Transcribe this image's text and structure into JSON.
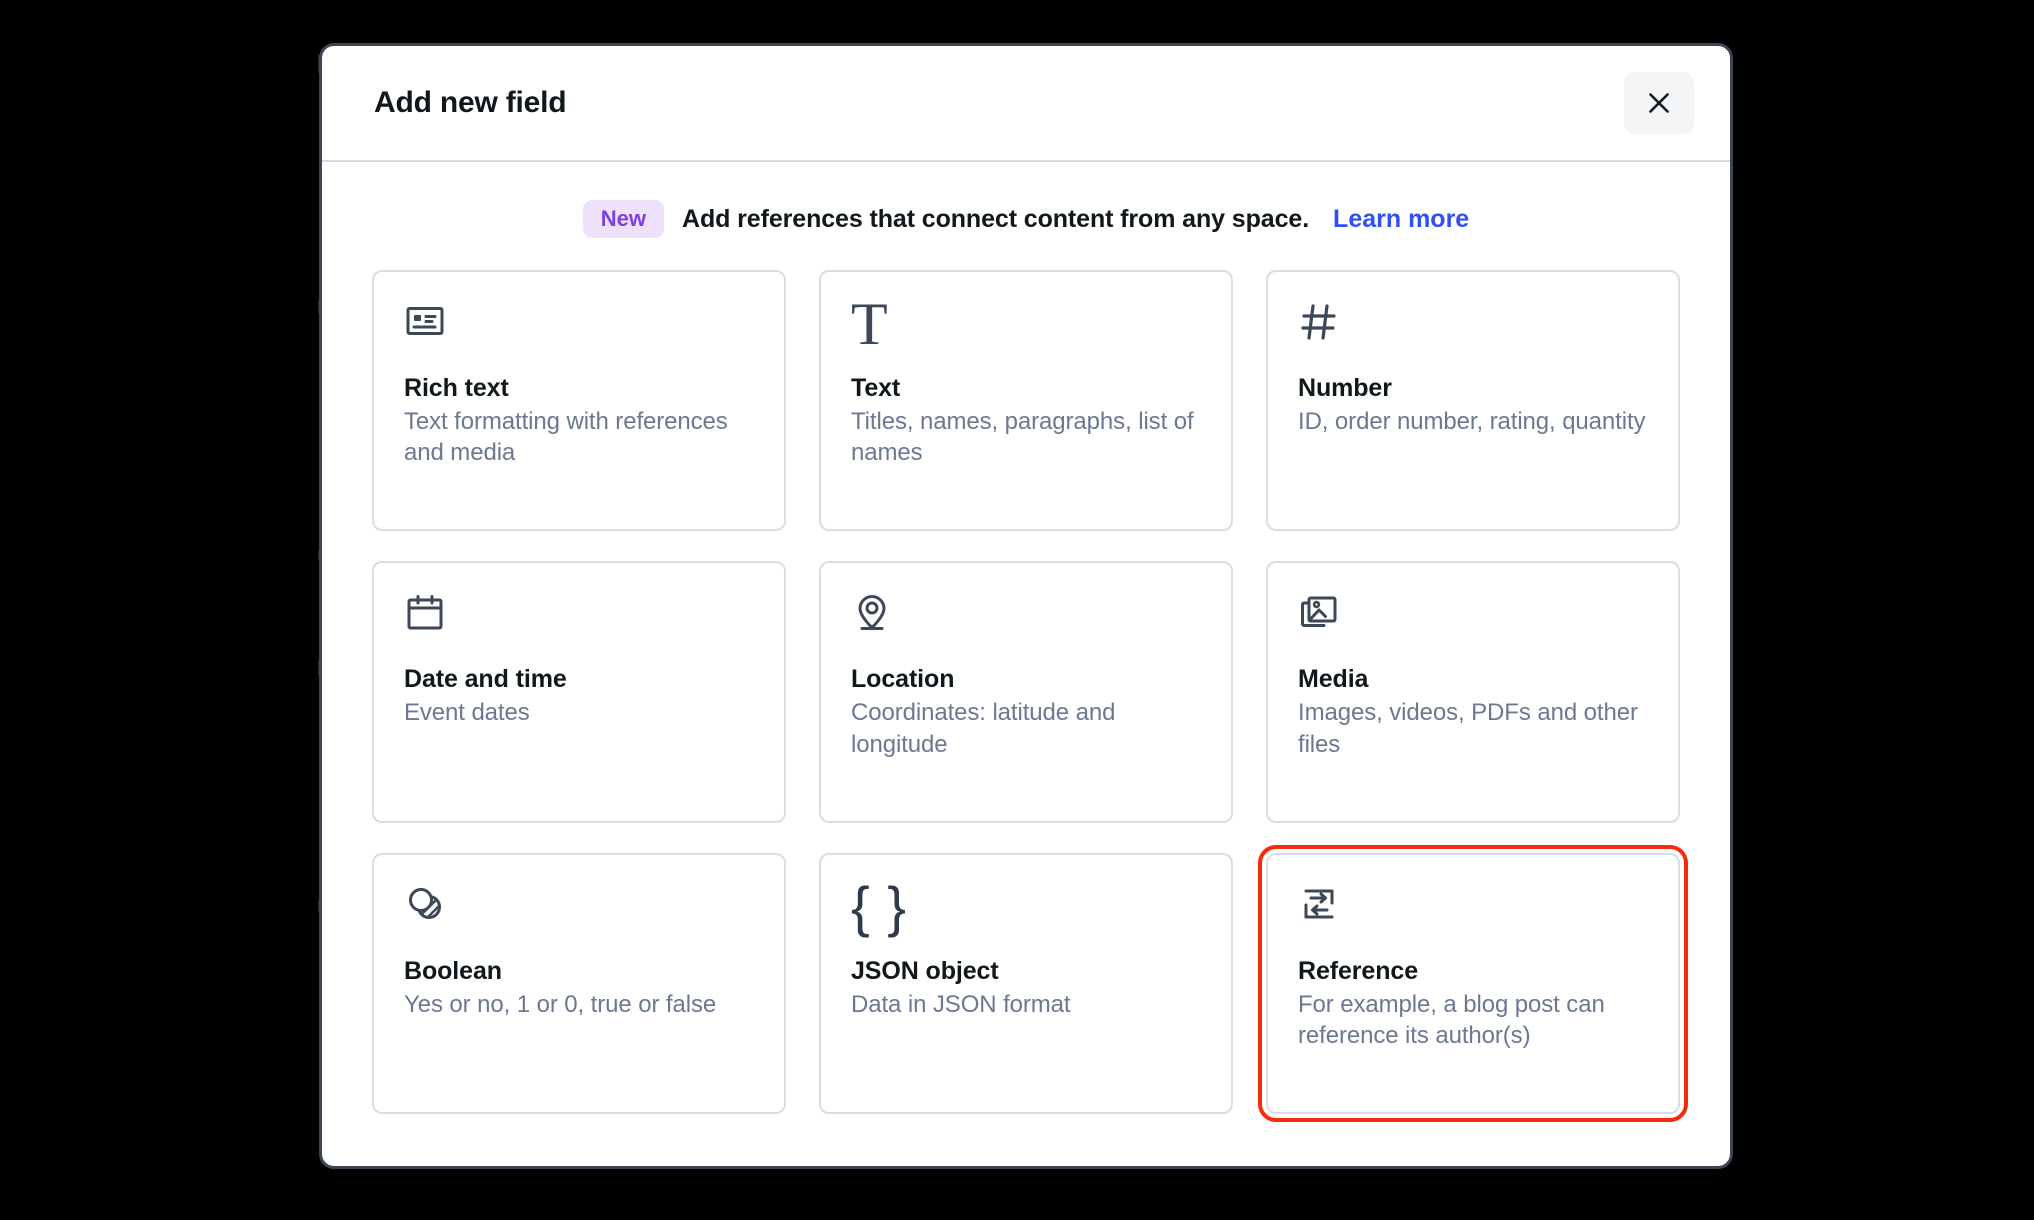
{
  "dialog": {
    "title": "Add new field",
    "close_label": "Close",
    "close_icon": "close-icon"
  },
  "banner": {
    "badge": "New",
    "text": "Add references that connect content from any space.",
    "link": "Learn more",
    "badge_bg": "#eee2fb",
    "badge_color": "#7c3fe4",
    "link_color": "#2f4ff7"
  },
  "highlight": {
    "color": "#f92a0b",
    "target": "Reference"
  },
  "fields": [
    {
      "icon": "contact-card-icon",
      "title": "Rich text",
      "description": "Text formatting with references and media"
    },
    {
      "icon": "text-t-icon",
      "title": "Text",
      "description": "Titles, names, paragraphs, list of names"
    },
    {
      "icon": "hash-icon",
      "title": "Number",
      "description": "ID, order number, rating, quantity"
    },
    {
      "icon": "calendar-icon",
      "title": "Date and time",
      "description": "Event dates"
    },
    {
      "icon": "map-pin-icon",
      "title": "Location",
      "description": "Coordinates: latitude and longitude"
    },
    {
      "icon": "image-stack-icon",
      "title": "Media",
      "description": "Images, videos, PDFs and other files"
    },
    {
      "icon": "boolean-circles-icon",
      "title": "Boolean",
      "description": "Yes or no, 1 or 0, true or false"
    },
    {
      "icon": "curly-braces-icon",
      "title": "JSON object",
      "description": "Data in JSON format"
    },
    {
      "icon": "reference-swap-icon",
      "title": "Reference",
      "description": "For example, a blog post can reference its author(s)"
    }
  ]
}
